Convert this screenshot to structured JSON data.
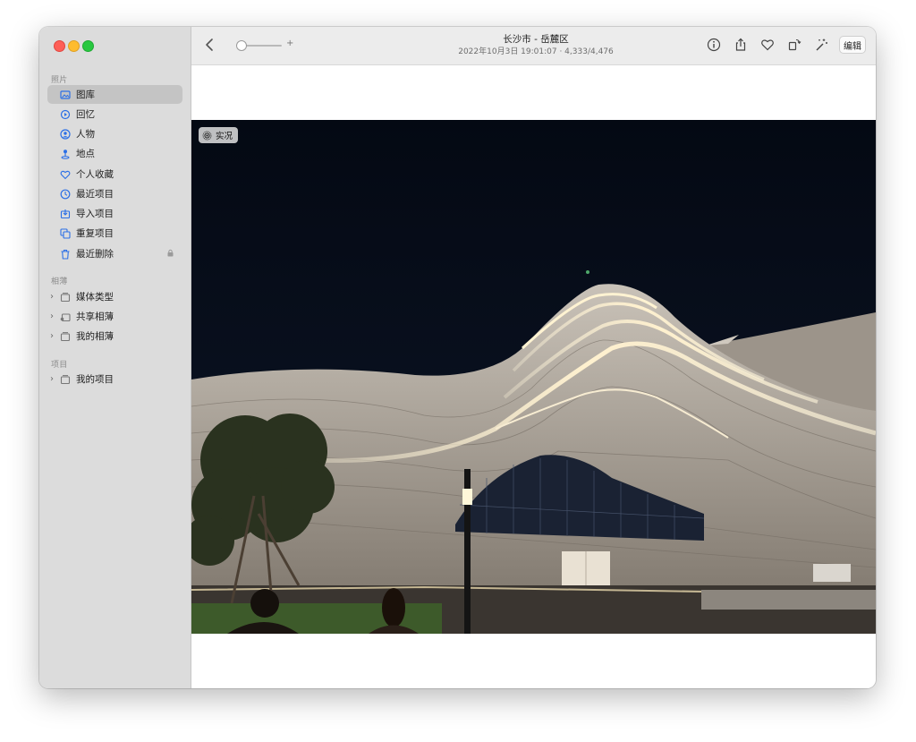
{
  "sidebar": {
    "sections": [
      {
        "header": "照片",
        "items": [
          {
            "label": "图库",
            "icon": "photo-library-icon",
            "selected": true
          },
          {
            "label": "回忆",
            "icon": "memories-icon"
          },
          {
            "label": "人物",
            "icon": "people-icon"
          },
          {
            "label": "地点",
            "icon": "places-icon"
          },
          {
            "label": "个人收藏",
            "icon": "heart-icon"
          },
          {
            "label": "最近项目",
            "icon": "clock-icon"
          },
          {
            "label": "导入项目",
            "icon": "import-icon"
          },
          {
            "label": "重复项目",
            "icon": "duplicates-icon"
          },
          {
            "label": "最近删除",
            "icon": "trash-icon",
            "locked": true
          }
        ]
      },
      {
        "header": "相薄",
        "items": [
          {
            "label": "媒体类型",
            "icon": "album-stack-icon"
          },
          {
            "label": "共享相薄",
            "icon": "shared-album-icon"
          },
          {
            "label": "我的相薄",
            "icon": "album-stack-icon"
          }
        ]
      },
      {
        "header": "项目",
        "items": [
          {
            "label": "我的项目",
            "icon": "album-stack-icon"
          }
        ]
      }
    ]
  },
  "toolbar": {
    "title": "长沙市 - 岳麓区",
    "subtitle": "2022年10月3日 19:01:07 · 4,333/4,476",
    "zoom_plus": "+",
    "edit_label": "编辑",
    "icons": [
      "info-icon",
      "share-icon",
      "favorite-heart-icon",
      "rotate-icon",
      "magic-wand-icon"
    ]
  },
  "photo": {
    "live_badge": "实况",
    "colors": {
      "sky": "#050b17",
      "building": "#b7b0a7",
      "light": "#fff1cf"
    }
  }
}
